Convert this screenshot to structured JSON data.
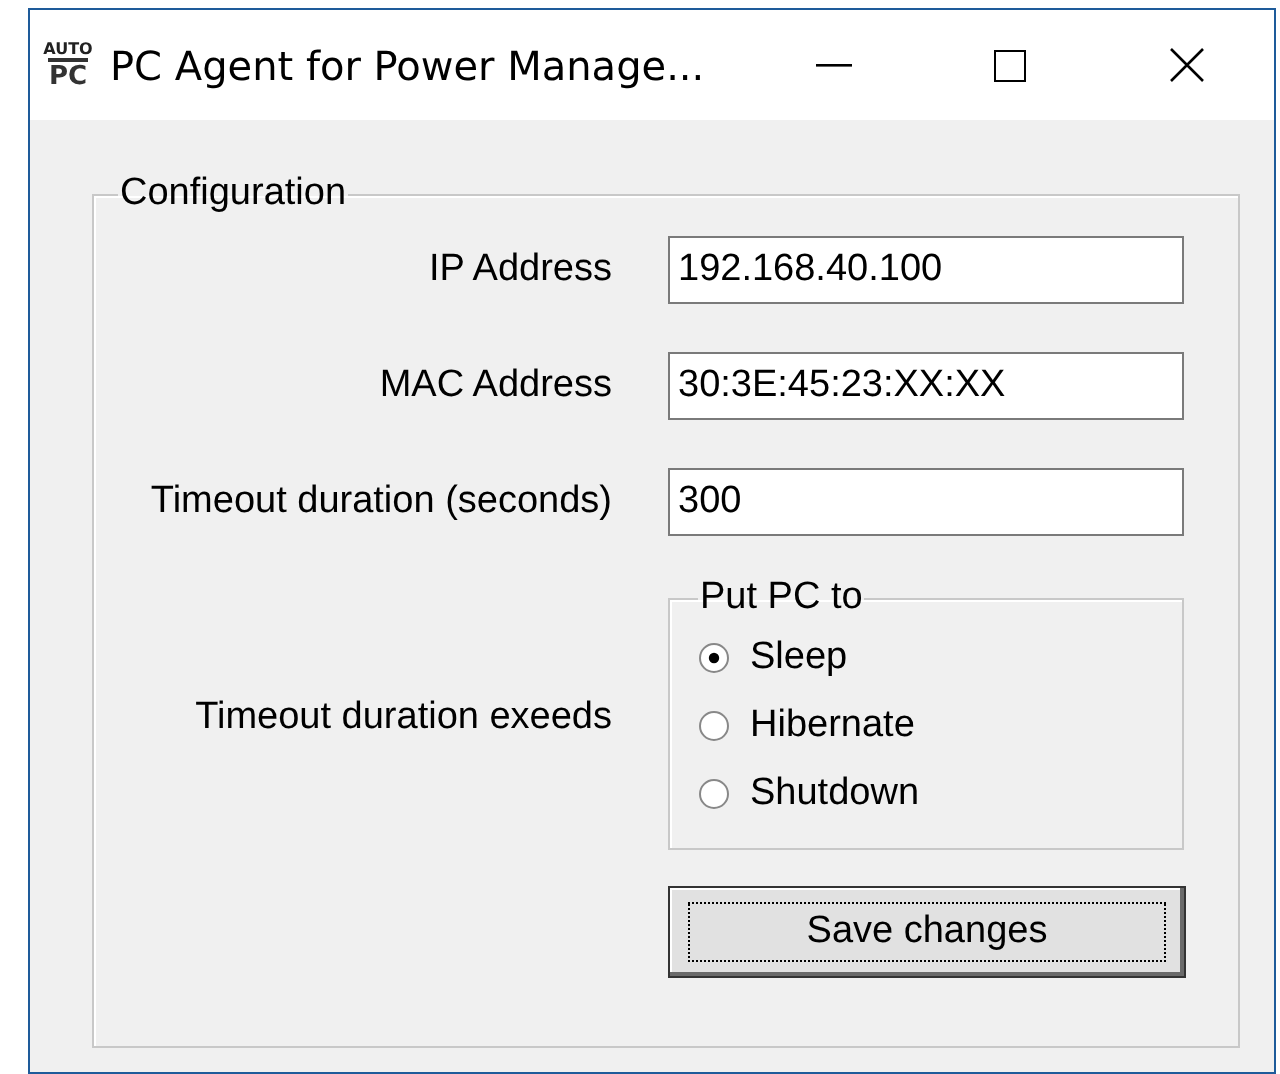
{
  "window": {
    "title": "PC Agent for Power Manage...",
    "logo": {
      "top": "AUTO",
      "bottom": "PC"
    }
  },
  "configuration": {
    "title": "Configuration",
    "fields": [
      {
        "label": "IP Address",
        "value": "192.168.40.100"
      },
      {
        "label": "MAC Address",
        "value": "30:3E:45:23:XX:XX"
      },
      {
        "label": "Timeout duration (seconds)",
        "value": "300"
      }
    ],
    "timeout_action": {
      "label": "Timeout duration exeeds",
      "group_title": "Put PC to",
      "options": [
        {
          "label": "Sleep",
          "selected": true
        },
        {
          "label": "Hibernate",
          "selected": false
        },
        {
          "label": "Shutdown",
          "selected": false
        }
      ]
    },
    "save_button": {
      "label": "Save changes",
      "focused": true
    }
  }
}
